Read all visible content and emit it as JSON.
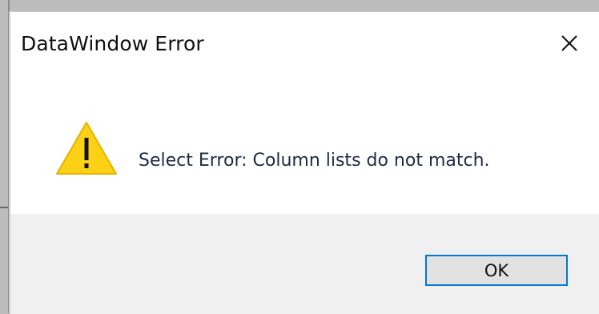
{
  "dialog": {
    "title": "DataWindow Error",
    "message": "Select Error: Column lists do not match.",
    "ok_label": "OK",
    "icons": {
      "warning": "warning-icon",
      "close": "close-icon"
    }
  },
  "colors": {
    "warning_fill": "#fcd116",
    "warning_stroke": "#e7b200",
    "ok_border": "#0078d7",
    "footer_bg": "#f0f0f0"
  }
}
